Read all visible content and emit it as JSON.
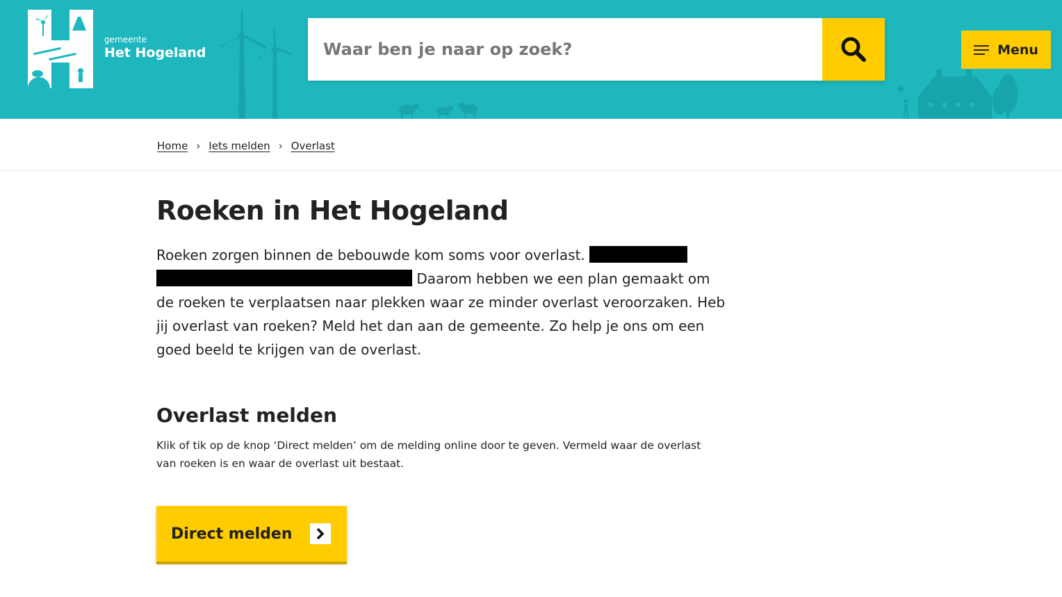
{
  "colors": {
    "header_bg": "#1db7bd",
    "accent": "#ffcc00",
    "text": "#222222"
  },
  "header": {
    "logo_small": "gemeente",
    "logo_big": "Het Hogeland",
    "search_placeholder": "Waar ben je naar op zoek?",
    "search_icon": "search-icon",
    "menu_label": "Menu",
    "menu_icon": "hamburger-icon"
  },
  "breadcrumb": [
    {
      "label": "Home"
    },
    {
      "label": "Iets melden"
    },
    {
      "label": "Overlast"
    }
  ],
  "main": {
    "title": "Roeken in Het Hogeland",
    "intro_part1": "Roeken zorgen binnen de bebouwde kom soms voor overlast.",
    "intro_part2": "Daarom hebben we een plan gemaakt om de roeken te verplaatsen naar plekken waar ze minder overlast veroorzaken. Heb jij overlast van roeken? Meld het dan aan de gemeente. Zo help je ons om een goed beeld te krijgen van de overlast.",
    "section_title": "Overlast melden",
    "section_text": "Klik of tik op de knop ‘Direct melden’ om de melding online door te geven. Vermeld waar de overlast van roeken is en waar de overlast uit bestaat.",
    "cta_label": "Direct melden",
    "cta_icon": "chevron-right-icon"
  }
}
